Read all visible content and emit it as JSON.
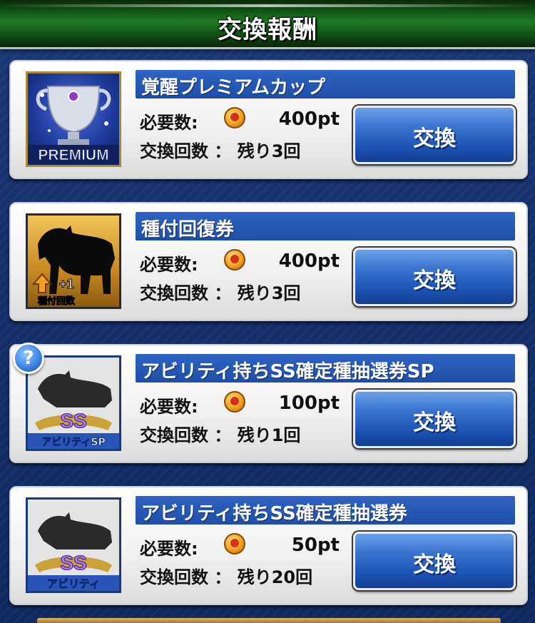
{
  "header": {
    "title": "交換報酬"
  },
  "labels": {
    "required": "必要数:",
    "count": "交換回数 ： 残り",
    "exchange_button": "交換"
  },
  "items": [
    {
      "title": "覚醒プレミアムカップ",
      "thumbnail_icon": "premium-cup-icon",
      "thumbnail_text": "PREMIUM",
      "points": "400pt",
      "remaining": "3回"
    },
    {
      "title": "種付回復券",
      "thumbnail_icon": "horse-silhouette-icon",
      "thumbnail_text": "種付回数",
      "thumbnail_badge": "+1",
      "points": "400pt",
      "remaining": "3回"
    },
    {
      "title": "アビリティ持ちSS確定種抽選券SP",
      "thumbnail_icon": "horse-silhouette-icon",
      "thumbnail_text": "アビリティSP",
      "thumbnail_badge": "SS",
      "points": "100pt",
      "remaining": "1回",
      "help": "?"
    },
    {
      "title": "アビリティ持ちSS確定種抽選券",
      "thumbnail_icon": "horse-silhouette-icon",
      "thumbnail_text": "アビリティ",
      "thumbnail_badge": "SS",
      "points": "50pt",
      "remaining": "20回"
    }
  ],
  "colors": {
    "header_green": "#1f7a22",
    "title_bar_blue": "#1e4ea8",
    "button_blue": "#1f55b8",
    "background_navy": "#14306b"
  }
}
